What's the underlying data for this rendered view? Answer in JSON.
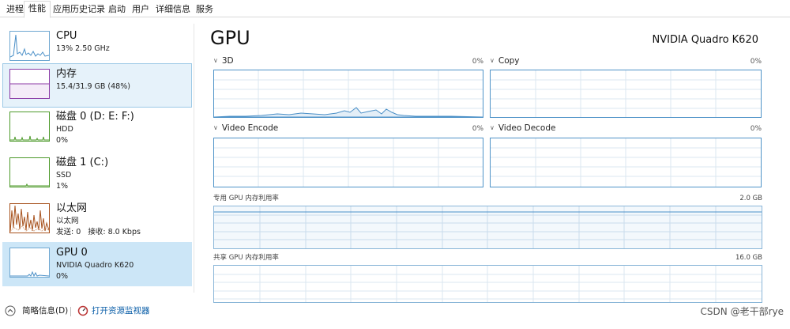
{
  "tabs": [
    "进程",
    "性能",
    "应用历史记录",
    "启动",
    "用户",
    "详细信息",
    "服务"
  ],
  "active_tab": "性能",
  "sidebar": {
    "items": [
      {
        "title": "CPU",
        "line1": "13% 2.50 GHz",
        "line2": "",
        "line3": ""
      },
      {
        "title": "内存",
        "line1": "15.4/31.9 GB (48%)",
        "line2": "",
        "line3": ""
      },
      {
        "title": "磁盘 0 (D: E: F:)",
        "line1": "HDD",
        "line2": "0%",
        "line3": ""
      },
      {
        "title": "磁盘 1 (C:)",
        "line1": "SSD",
        "line2": "1%",
        "line3": ""
      },
      {
        "title": "以太网",
        "line1": "以太网",
        "line2": "",
        "line3": ""
      },
      {
        "title": "GPU 0",
        "line1": "NVIDIA Quadro K620",
        "line2": "0%",
        "line3": ""
      }
    ],
    "ethernet": {
      "send_label": "发送:",
      "send_value": "0",
      "recv_label": "接收:",
      "recv_value": "8.0 Kbps"
    }
  },
  "main": {
    "title": "GPU",
    "model": "NVIDIA Quadro K620",
    "engines": [
      {
        "name": "3D",
        "percent": "0%"
      },
      {
        "name": "Copy",
        "percent": "0%"
      },
      {
        "name": "Video Encode",
        "percent": "0%"
      },
      {
        "name": "Video Decode",
        "percent": "0%"
      }
    ],
    "dedicated_label": "专用 GPU 内存利用率",
    "dedicated_max": "2.0 GB",
    "shared_label": "共享 GPU 内存利用率",
    "shared_max": "16.0 GB"
  },
  "footer": {
    "brief_label": "简略信息(D)",
    "monitor_link": "打开资源监视器"
  },
  "watermark": "CSDN @老干部rye",
  "colors": {
    "cpu": "#4a8fc7",
    "memory": "#8b3aa6",
    "disk": "#4d9a2a",
    "ethernet": "#a7521d",
    "gpu": "#4a8fc7",
    "selected": "#cce6f7",
    "link": "#0a5ea8"
  }
}
